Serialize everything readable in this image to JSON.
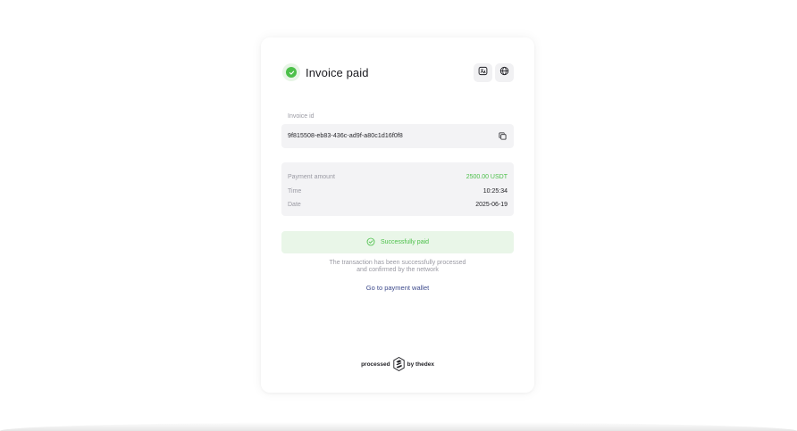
{
  "header": {
    "title": "Invoice paid",
    "status_icon": "check-circle-icon",
    "actions": [
      {
        "name": "language-action",
        "icon": "language-icon"
      },
      {
        "name": "globe-action",
        "icon": "globe-icon"
      }
    ]
  },
  "invoice": {
    "label": "Invoice id",
    "id": "9f815508-eb83-436c-ad9f-a80c1d16f0f8",
    "copy_icon": "copy-icon"
  },
  "details": {
    "rows": [
      {
        "key": "Payment amount",
        "value": "2500.00 USDT"
      },
      {
        "key": "Time",
        "value": "10:25:34"
      },
      {
        "key": "Date",
        "value": "2025-06-19"
      }
    ]
  },
  "status": {
    "text": "Successfully paid",
    "description_line1": "The transaction has been successfully processed",
    "description_line2": "and confirmed by the network"
  },
  "wallet_link": "Go to payment wallet",
  "footer": {
    "prefix": "processed",
    "suffix": "by thedex",
    "logo_icon": "thedex-logo-icon"
  },
  "colors": {
    "accent_green": "#4cc04a",
    "banner_green": "#e9f6e8",
    "link_blue": "#3d4a8c",
    "muted_text": "#9a9aa3",
    "panel_bg": "#f3f3f5"
  }
}
